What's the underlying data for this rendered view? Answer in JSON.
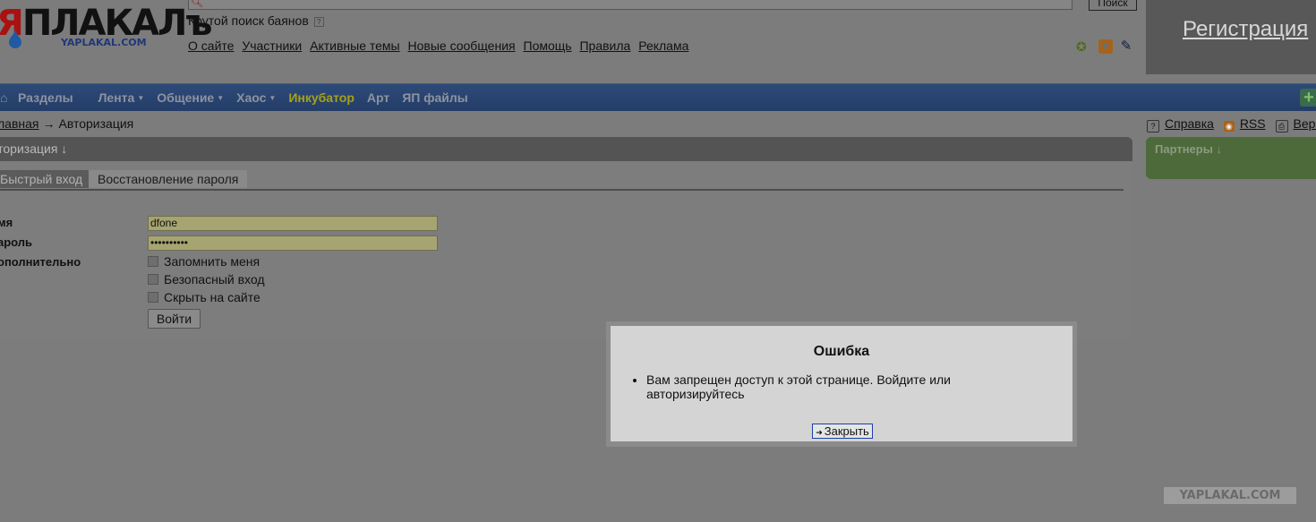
{
  "header": {
    "logo_text": "ЯПЛАКАЛъ",
    "logo_sub": "YAPLAKAL.COM",
    "search_button": "Поиск",
    "slogan": "Крутой поиск баянов",
    "slogan_help": "?",
    "nav": [
      "О сайте",
      "Участники",
      "Активные темы",
      "Новые сообщения",
      "Помощь",
      "Правила",
      "Реклама"
    ],
    "register": "Регистрация"
  },
  "menu": {
    "items": [
      {
        "label": "Разделы",
        "arrow": ""
      },
      {
        "label": "Лента",
        "arrow": "▼"
      },
      {
        "label": "Общение",
        "arrow": "▼"
      },
      {
        "label": "Хаос",
        "arrow": "▼"
      },
      {
        "label": "Инкубатор",
        "arrow": ""
      },
      {
        "label": "Арт",
        "arrow": ""
      },
      {
        "label": "ЯП файлы",
        "arrow": ""
      }
    ],
    "plus": "+"
  },
  "breadcrumb": {
    "home": "лавная",
    "sep": "→",
    "current": "Авторизация"
  },
  "side_links": {
    "help": "Справка",
    "rss": "RSS",
    "version": "Верс"
  },
  "auth": {
    "title": "вторизация ↓",
    "tabs": {
      "quick": "Быстрый вход",
      "recover": "Восстановление пароля"
    },
    "labels": {
      "name": "мя",
      "password": "ароль",
      "extra": "ополнительно"
    },
    "values": {
      "name": "dfone",
      "password": "••••••••••"
    },
    "checks": [
      "Запомнить меня",
      "Безопасный вход",
      "Скрыть на сайте"
    ],
    "submit": "Войти"
  },
  "partners": {
    "title": "Партнеры ↓"
  },
  "dialog": {
    "title": "Ошибка",
    "message": "Вам запрещен доступ к этой странице. Войдите или авторизируйтесь",
    "close": "Закрыть"
  },
  "watermark": "YAPLAKAL.COM"
}
